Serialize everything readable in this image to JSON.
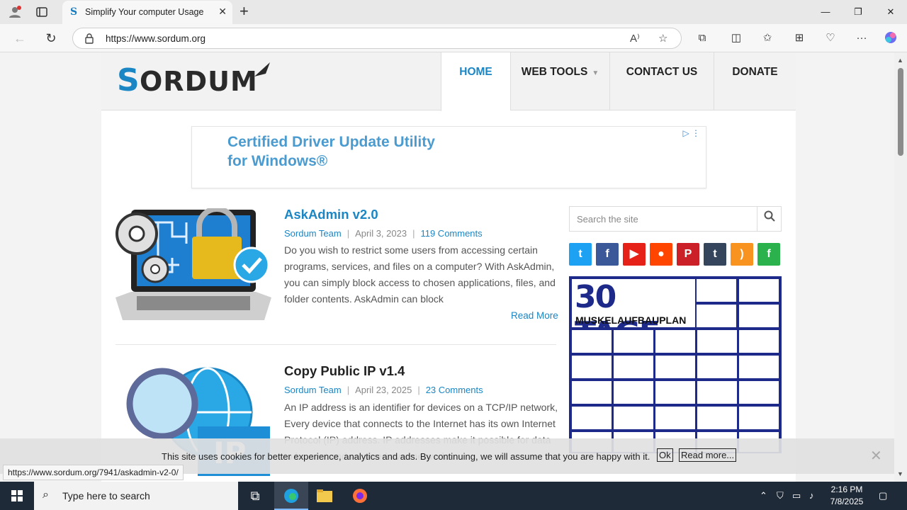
{
  "browser": {
    "tab_title": "Simplify Your computer Usage",
    "url": "https://www.sordum.org",
    "status_url": "https://www.sordum.org/7941/askadmin-v2-0/"
  },
  "site": {
    "menu": [
      {
        "label": "HOME",
        "active": true
      },
      {
        "label": "WEB TOOLS",
        "dropdown": true
      },
      {
        "label": "CONTACT US"
      },
      {
        "label": "DONATE"
      }
    ],
    "ad_top_text": "Certified Driver Update Utility for Windows®",
    "posts": [
      {
        "title": "AskAdmin v2.0",
        "author": "Sordum Team",
        "date": "April 3, 2023",
        "comments": "119 Comments",
        "excerpt": "Do you wish to restrict some users from accessing certain programs, services, and files on a computer? With AskAdmin, you can simply block access to chosen applications, files, and folder contents. AskAdmin can block",
        "read_more": "Read More"
      },
      {
        "title": "Copy Public IP v1.4",
        "author": "Sordum Team",
        "date": "April 23, 2025",
        "comments": "23 Comments",
        "excerpt": "An IP address is an identifier for devices on a TCP/IP network, Every device that connects to the Internet has its own Internet Protocol (IP) address. IP addresses make it possible for data to be sent and received over networks"
      }
    ],
    "search_placeholder": "Search the site",
    "social": [
      "twitter",
      "facebook",
      "youtube",
      "reddit",
      "pinterest",
      "tumblr",
      "rss",
      "feedly"
    ],
    "ad_side": {
      "headline": "30 TAGE",
      "subline": "MUSKELAUFBAUPLAN"
    },
    "cookie": {
      "text": "This site uses cookies for better experience, analytics and ads. By continuing, we will assume that you are happy with it.",
      "ok": "Ok",
      "read_more": "Read more..."
    }
  },
  "taskbar": {
    "search_text": "Type here to search",
    "time": "2:16 PM",
    "date": "7/8/2025"
  },
  "colors": {
    "accent": "#1b86c4",
    "taskbar": "#1f2a38"
  }
}
